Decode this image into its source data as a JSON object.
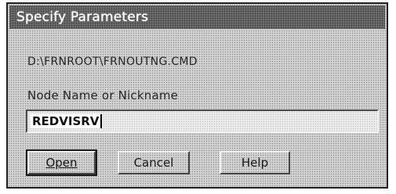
{
  "dialog": {
    "title": "Specify Parameters",
    "path": "D:\\FRNROOT\\FRNOUTNG.CMD",
    "field_label": "Node Name or Nickname",
    "field_value": "REDVISRV"
  },
  "buttons": {
    "open_label": "Open",
    "cancel_label": "Cancel",
    "help_label": "Help"
  }
}
